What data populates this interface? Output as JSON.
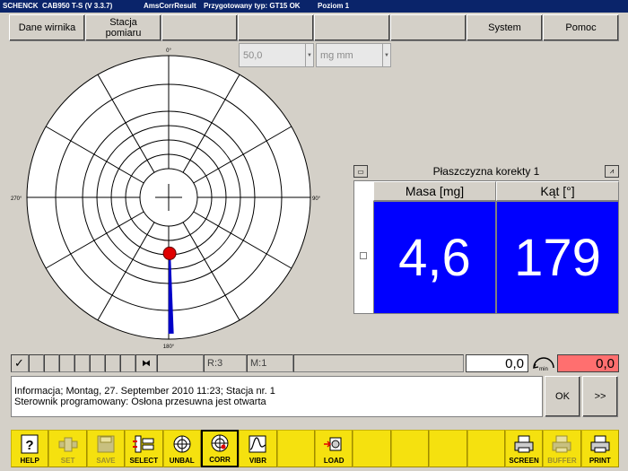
{
  "title_bar": {
    "brand": "SCHENCK",
    "app": "CAB950 T-S (V 3.3.7)",
    "screen": "AmsCorrResult",
    "type_prepared": "Przygotowany typ: GT15 OK",
    "level": "Poziom 1"
  },
  "menu": {
    "dane_wirnika": "Dane wirnika",
    "stacja_pomiaru_1": "Stacja",
    "stacja_pomiaru_2": "pomiaru",
    "system": "System",
    "pomoc": "Pomoc"
  },
  "selects": {
    "value": "50,0",
    "unit": "mg mm"
  },
  "polar": {
    "angle_top": "0°",
    "angle_right": "90°",
    "angle_bottom": "180°",
    "angle_left": "270°",
    "ring_count": 5,
    "point_angle_deg": 179,
    "point_magnitude_rings": 1.95,
    "vector_color": "#0000c8",
    "point_color": "#e00000"
  },
  "panel": {
    "title": "Płaszczyzna korekty 1",
    "col_masa": "Masa [mg]",
    "col_kat": "Kąt [°]",
    "masa_value": "4,6",
    "kat_value": "179",
    "value_bg": "#0000ff"
  },
  "status": {
    "r_label": "R:3",
    "m_label": "M:1",
    "value_white": "0,0",
    "min_label": "min",
    "value_red": "0,0",
    "red_bg": "#ff6f6f"
  },
  "info": {
    "line1": "Informacja;  Montag, 27. September 2010 11:23;   Stacja nr. 1",
    "line2": "Sterownik programowany: Osłona przesuwna jest otwarta"
  },
  "buttons": {
    "ok": "OK",
    "next": ">>"
  },
  "toolbar": {
    "help": "HELP",
    "set": "SET",
    "save": "SAVE",
    "select": "SELECT",
    "unbal": "UNBAL",
    "corr": "CORR",
    "vibr": "VIBR",
    "load": "LOAD",
    "screen": "SCREEN",
    "buffer": "BUFFER",
    "print": "PRINT"
  }
}
